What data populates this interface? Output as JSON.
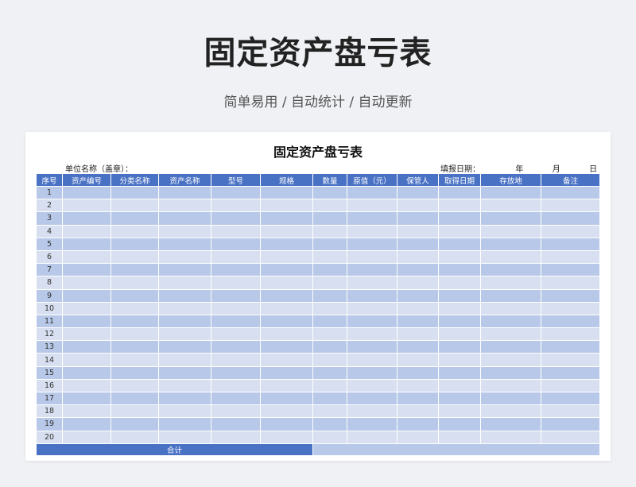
{
  "hero": {
    "title": "固定资产盘亏表",
    "subtitle": "简单易用  /  自动统计  /  自动更新"
  },
  "sheet": {
    "title": "固定资产盘亏表",
    "unit_label": "单位名称（盖章）：",
    "date_label": "填报日期：",
    "year_label": "年",
    "month_label": "月",
    "day_label": "日",
    "columns": [
      "序号",
      "资产编号",
      "分类名称",
      "资产名称",
      "型号",
      "规格",
      "数量",
      "原值（元）",
      "保管人",
      "取得日期",
      "存放地",
      "备注"
    ],
    "rows": [
      "1",
      "2",
      "3",
      "4",
      "5",
      "6",
      "7",
      "8",
      "9",
      "10",
      "11",
      "12",
      "13",
      "14",
      "15",
      "16",
      "17",
      "18",
      "19",
      "20"
    ],
    "total_label": "合计"
  },
  "colors": {
    "header_blue": "#4a72c4",
    "row_dark": "#b7c8e8",
    "row_light": "#d7dff0"
  }
}
